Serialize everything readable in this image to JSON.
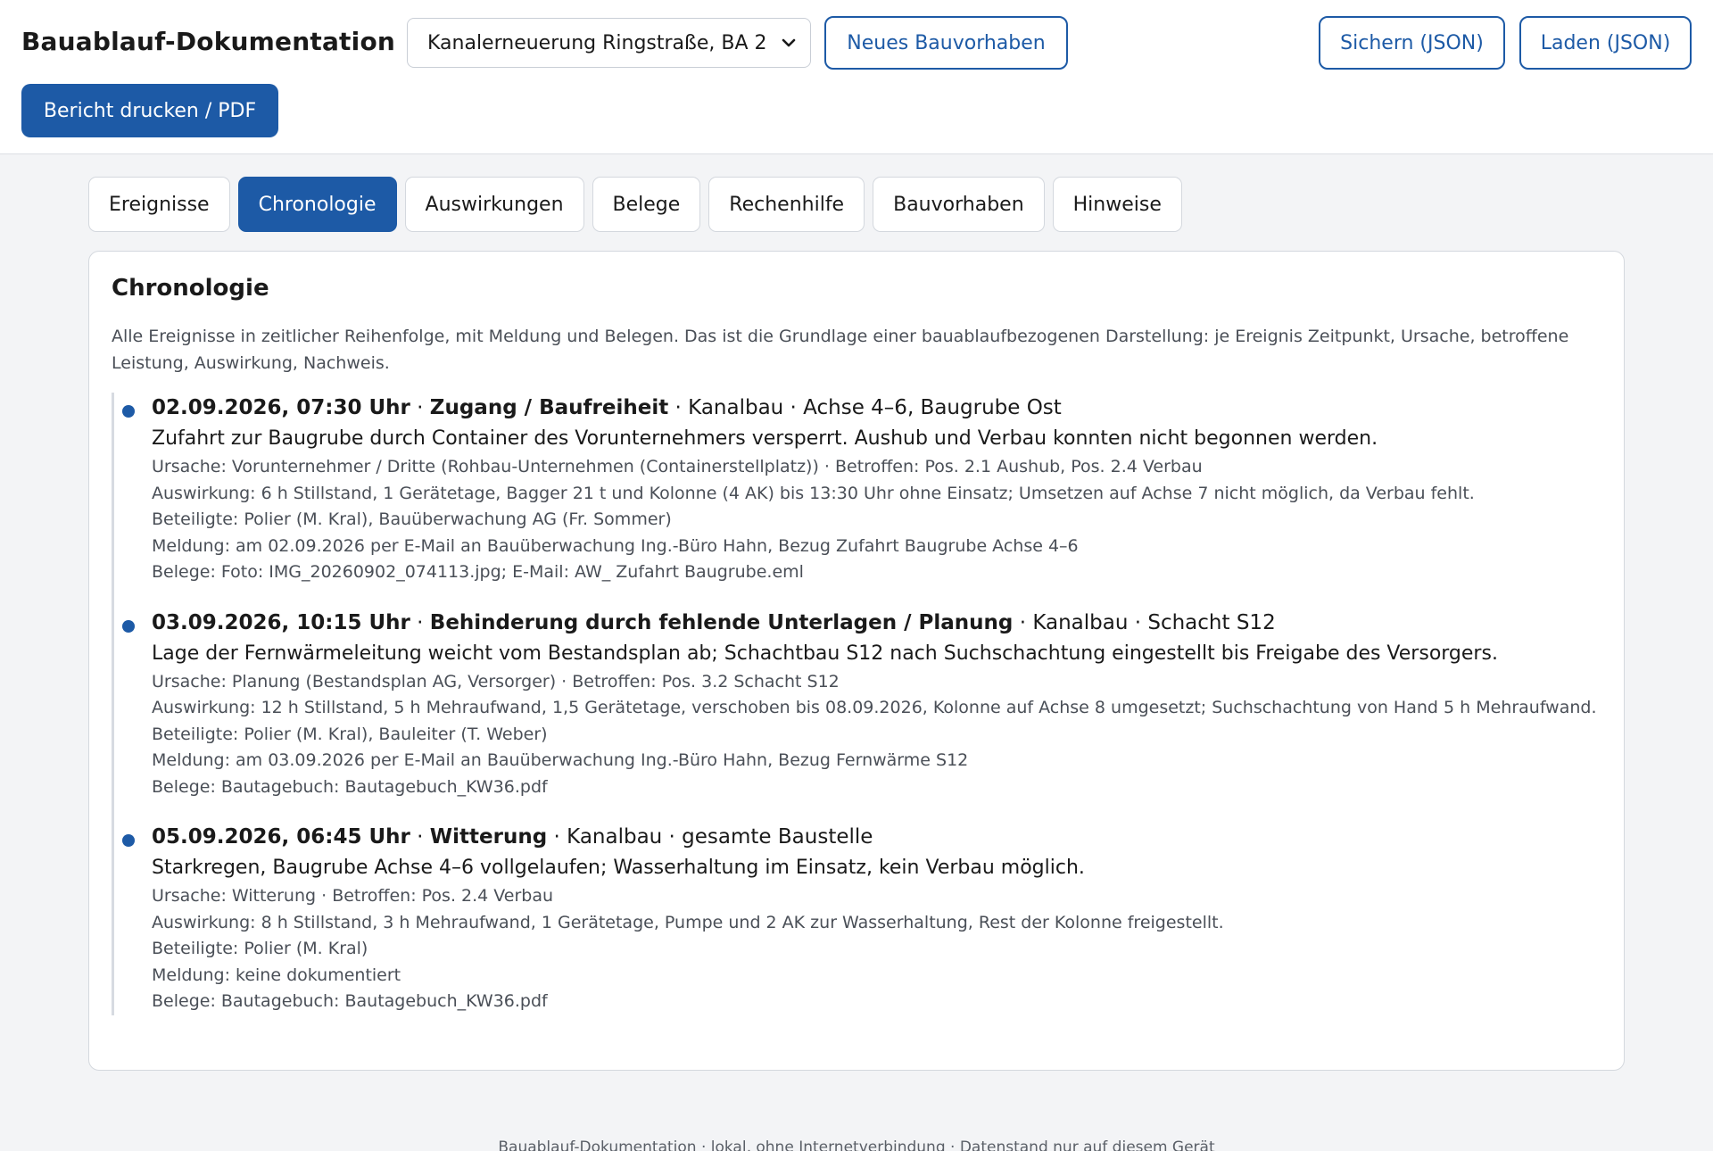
{
  "header": {
    "title": "Bauablauf-Dokumentation",
    "project_select": {
      "value": "Kanalerneuerung Ringstraße, BA 2"
    },
    "new_project_label": "Neues Bauvorhaben",
    "print_label": "Bericht drucken / PDF",
    "save_label": "Sichern (JSON)",
    "load_label": "Laden (JSON)"
  },
  "tabs": [
    {
      "label": "Ereignisse",
      "active": false
    },
    {
      "label": "Chronologie",
      "active": true
    },
    {
      "label": "Auswirkungen",
      "active": false
    },
    {
      "label": "Belege",
      "active": false
    },
    {
      "label": "Rechenhilfe",
      "active": false
    },
    {
      "label": "Bauvorhaben",
      "active": false
    },
    {
      "label": "Hinweise",
      "active": false
    }
  ],
  "panel": {
    "title": "Chronologie",
    "description": "Alle Ereignisse in zeitlicher Reihenfolge, mit Meldung und Belegen. Das ist die Grundlage einer bauablaufbezogenen Darstellung: je Ereignis Zeitpunkt, Ursache, betroffene Leistung, Auswirkung, Nachweis."
  },
  "events": [
    {
      "datetime": "02.09.2026, 07:30 Uhr",
      "category": "Zugang / Baufreiheit",
      "meta": " · Kanalbau · Achse 4–6, Baugrube Ost",
      "description": "Zufahrt zur Baugrube durch Container des Vorunternehmers versperrt. Aushub und Verbau konnten nicht begonnen werden.",
      "cause": "Ursache: Vorunternehmer / Dritte (Rohbau-Unternehmen (Containerstellplatz)) · Betroffen: Pos. 2.1 Aushub, Pos. 2.4 Verbau",
      "impact": "Auswirkung: 6 h Stillstand, 1 Gerätetage, Bagger 21 t und Kolonne (4 AK) bis 13:30 Uhr ohne Einsatz; Umsetzen auf Achse 7 nicht möglich, da Verbau fehlt.",
      "participants": "Beteiligte: Polier (M. Kral), Bauüberwachung AG (Fr. Sommer)",
      "notice": "Meldung: am 02.09.2026 per E-Mail an Bauüberwachung Ing.-Büro Hahn, Bezug Zufahrt Baugrube Achse 4–6",
      "evidence": "Belege: Foto: IMG_20260902_074113.jpg; E-Mail: AW_ Zufahrt Baugrube.eml"
    },
    {
      "datetime": "03.09.2026, 10:15 Uhr",
      "category": "Behinderung durch fehlende Unterlagen / Planung",
      "meta": " · Kanalbau · Schacht S12",
      "description": "Lage der Fernwärmeleitung weicht vom Bestandsplan ab; Schachtbau S12 nach Suchschachtung eingestellt bis Freigabe des Versorgers.",
      "cause": "Ursache: Planung (Bestandsplan AG, Versorger) · Betroffen: Pos. 3.2 Schacht S12",
      "impact": "Auswirkung: 12 h Stillstand, 5 h Mehraufwand, 1,5 Gerätetage, verschoben bis 08.09.2026, Kolonne auf Achse 8 umgesetzt; Suchschachtung von Hand 5 h Mehraufwand.",
      "participants": "Beteiligte: Polier (M. Kral), Bauleiter (T. Weber)",
      "notice": "Meldung: am 03.09.2026 per E-Mail an Bauüberwachung Ing.-Büro Hahn, Bezug Fernwärme S12",
      "evidence": "Belege: Bautagebuch: Bautagebuch_KW36.pdf"
    },
    {
      "datetime": "05.09.2026, 06:45 Uhr",
      "category": "Witterung",
      "meta": " · Kanalbau · gesamte Baustelle",
      "description": "Starkregen, Baugrube Achse 4–6 vollgelaufen; Wasserhaltung im Einsatz, kein Verbau möglich.",
      "cause": "Ursache: Witterung · Betroffen: Pos. 2.4 Verbau",
      "impact": "Auswirkung: 8 h Stillstand, 3 h Mehraufwand, 1 Gerätetage, Pumpe und 2 AK zur Wasserhaltung, Rest der Kolonne freigestellt.",
      "participants": "Beteiligte: Polier (M. Kral)",
      "notice": "Meldung: keine dokumentiert",
      "evidence": "Belege: Bautagebuch: Bautagebuch_KW36.pdf"
    }
  ],
  "footer": {
    "text": "Bauablauf-Dokumentation · lokal, ohne Internetverbindung · Datenstand nur auf diesem Gerät"
  },
  "colors": {
    "accent": "#1d5aa6",
    "muted_text": "#4a4f57",
    "border": "#d4d8de"
  }
}
